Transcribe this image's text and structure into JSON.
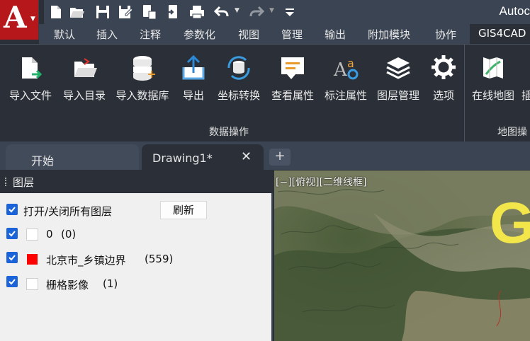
{
  "app": {
    "logo_letter": "A",
    "title": "Autoc"
  },
  "quick_access": {
    "icons": [
      "new-file-icon",
      "open-folder-icon",
      "save-icon",
      "save-as-icon",
      "open-from-web-icon",
      "save-to-web-icon",
      "print-icon",
      "undo-icon",
      "redo-icon",
      "customize-icon"
    ]
  },
  "ribbon_tabs": [
    "默认",
    "插入",
    "注释",
    "参数化",
    "视图",
    "管理",
    "输出",
    "附加模块",
    "协作",
    "GIS4CAD"
  ],
  "ribbon": {
    "tools": [
      {
        "label": "导入文件",
        "icon": "import-file-icon"
      },
      {
        "label": "导入目录",
        "icon": "import-folder-icon"
      },
      {
        "label": "导入数据库",
        "icon": "import-database-icon"
      },
      {
        "label": "导出",
        "icon": "export-icon"
      },
      {
        "label": "坐标转换",
        "icon": "coordinate-transform-icon"
      },
      {
        "label": "查看属性",
        "icon": "view-attributes-icon"
      },
      {
        "label": "标注属性",
        "icon": "label-attributes-icon"
      },
      {
        "label": "图层管理",
        "icon": "layer-manager-icon"
      },
      {
        "label": "选项",
        "icon": "gear-icon"
      },
      {
        "label": "在线地图",
        "icon": "online-map-icon"
      },
      {
        "label": "插",
        "icon": ""
      }
    ],
    "panels": {
      "data_ops": "数据操作",
      "map_ops": "地图操"
    }
  },
  "doc_tabs": {
    "start": "开始",
    "drawing": "Drawing1*",
    "close": "✕",
    "add": "+"
  },
  "layers": {
    "title": "图层",
    "toggle_all_label": "打开/关闭所有图层",
    "refresh_label": "刷新",
    "items": [
      {
        "name": "0",
        "count": "(0)",
        "color": "#ffffff",
        "checked": true
      },
      {
        "name": "北京市_乡镇边界",
        "count": "(559)",
        "color": "#ff0000",
        "checked": true
      },
      {
        "name": "栅格影像",
        "count": "(1)",
        "color": "#ffffff",
        "checked": true
      }
    ]
  },
  "viewport": {
    "label": "[−][俯视][二维线框]",
    "big_text": "G"
  },
  "colors": {
    "app_red": "#b5171b",
    "dark_bg": "#2b3038",
    "tab_bar": "#3b4453",
    "checkbox_blue": "#1b63d9",
    "label_yellow": "#f2e64a"
  }
}
